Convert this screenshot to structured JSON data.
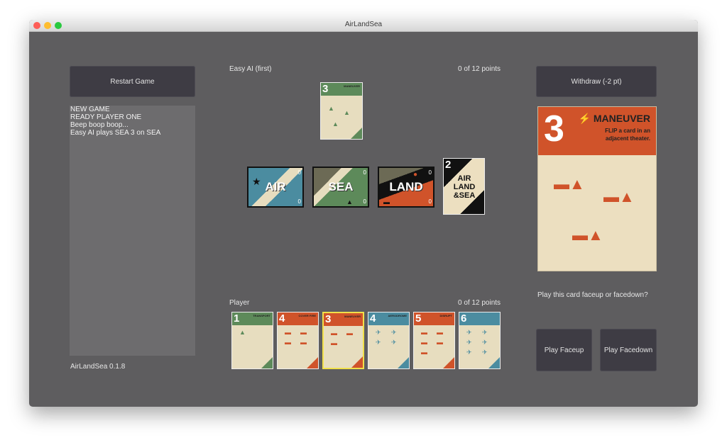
{
  "window": {
    "title": "AirLandSea"
  },
  "buttons": {
    "restart": "Restart Game",
    "withdraw": "Withdraw (-2 pt)",
    "play_faceup": "Play Faceup",
    "play_facedown": "Play Facedown"
  },
  "log": {
    "lines": [
      "NEW GAME",
      "READY PLAYER ONE",
      "Beep boop boop...",
      "Easy AI plays SEA 3 on SEA"
    ]
  },
  "version": "AirLandSea 0.1.8",
  "opponent": {
    "label": "Easy AI  (first)",
    "points": "0 of 12 points",
    "played_card": {
      "value": "3",
      "name": "MANEUVER",
      "theater": "SEA",
      "color": "#5d8a5a"
    }
  },
  "theaters": [
    {
      "name": "AIR",
      "score_top": "0",
      "score_bottom": "0",
      "color": "#4b8ca0"
    },
    {
      "name": "SEA",
      "score_top": "0",
      "score_bottom": "0",
      "color": "#5d8a5a"
    },
    {
      "name": "LAND",
      "score_top": "0",
      "score_bottom": "0",
      "color": "#d0532a"
    }
  ],
  "supreme_card": {
    "value": "2",
    "lines": [
      "AIR",
      "LAND",
      "&SEA"
    ]
  },
  "player": {
    "label": "Player",
    "points": "0 of 12 points",
    "hand": [
      {
        "value": "1",
        "name": "TRANSPORT",
        "color": "#5d8a5a",
        "icon": "ship-icon",
        "selected": false
      },
      {
        "value": "4",
        "name": "COVER FIRE",
        "color": "#d0532a",
        "icon": "tank-icon",
        "selected": false
      },
      {
        "value": "3",
        "name": "MANEUVER",
        "color": "#d0532a",
        "icon": "tank-icon",
        "selected": true
      },
      {
        "value": "4",
        "name": "AERODROME",
        "color": "#4b8ca0",
        "icon": "plane-icon",
        "selected": false
      },
      {
        "value": "5",
        "name": "DISRUPT",
        "color": "#d0532a",
        "icon": "tank-icon",
        "selected": false
      },
      {
        "value": "6",
        "name": "",
        "color": "#4b8ca0",
        "icon": "plane-icon",
        "selected": false
      }
    ]
  },
  "selected_card": {
    "value": "3",
    "name": "MANEUVER",
    "text_line1": "FLIP a card in an",
    "text_line2": "adjacent theater.",
    "color": "#d0532a"
  },
  "prompt": "Play this card faceup or facedown?"
}
